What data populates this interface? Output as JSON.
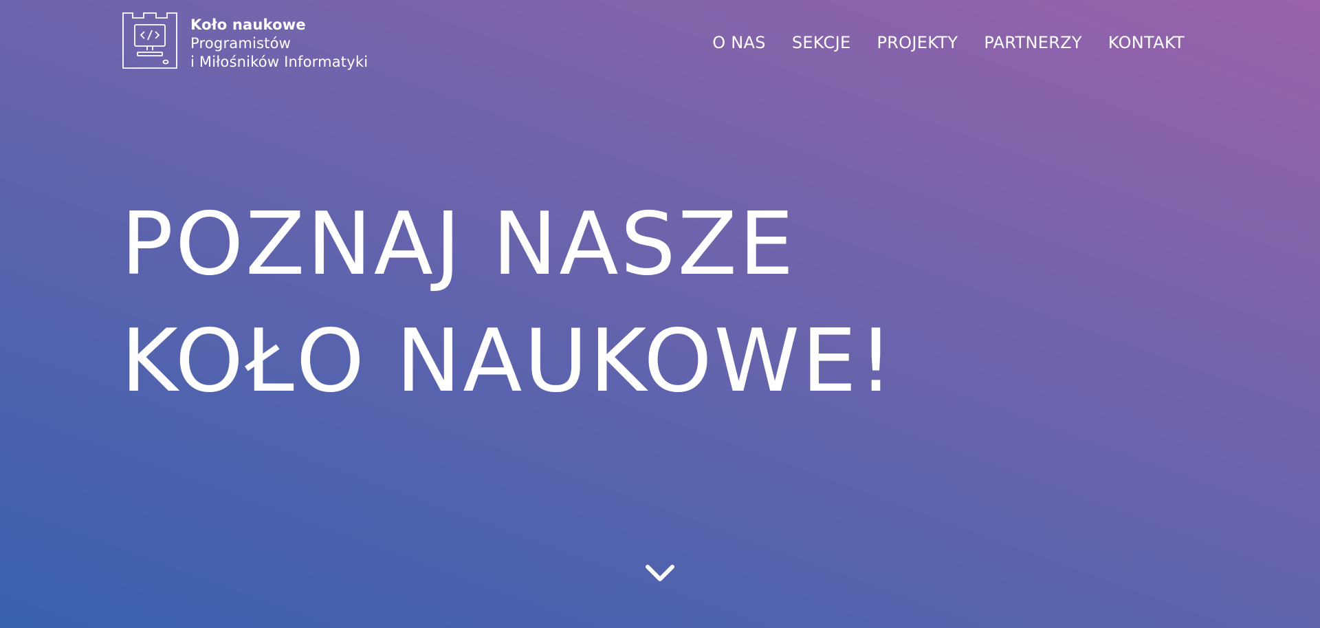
{
  "logo": {
    "title": "Koło naukowe",
    "line2": "Programistów",
    "line3": "i Miłośników Informatyki",
    "icon": "computer-castle-logo-icon"
  },
  "nav": {
    "items": [
      {
        "label": "O NAS"
      },
      {
        "label": "SEKCJE"
      },
      {
        "label": "PROJEKTY"
      },
      {
        "label": "PARTNERZY"
      },
      {
        "label": "KONTAKT"
      }
    ]
  },
  "hero": {
    "line1": "POZNAJ NASZE",
    "line2": "KOŁO NAUKOWE!"
  },
  "scroll": {
    "icon": "chevron-down-icon"
  },
  "colors": {
    "text": "#ffffff",
    "gradient_top_right": "#9a62ab",
    "gradient_bottom_left": "#3a62ae"
  }
}
